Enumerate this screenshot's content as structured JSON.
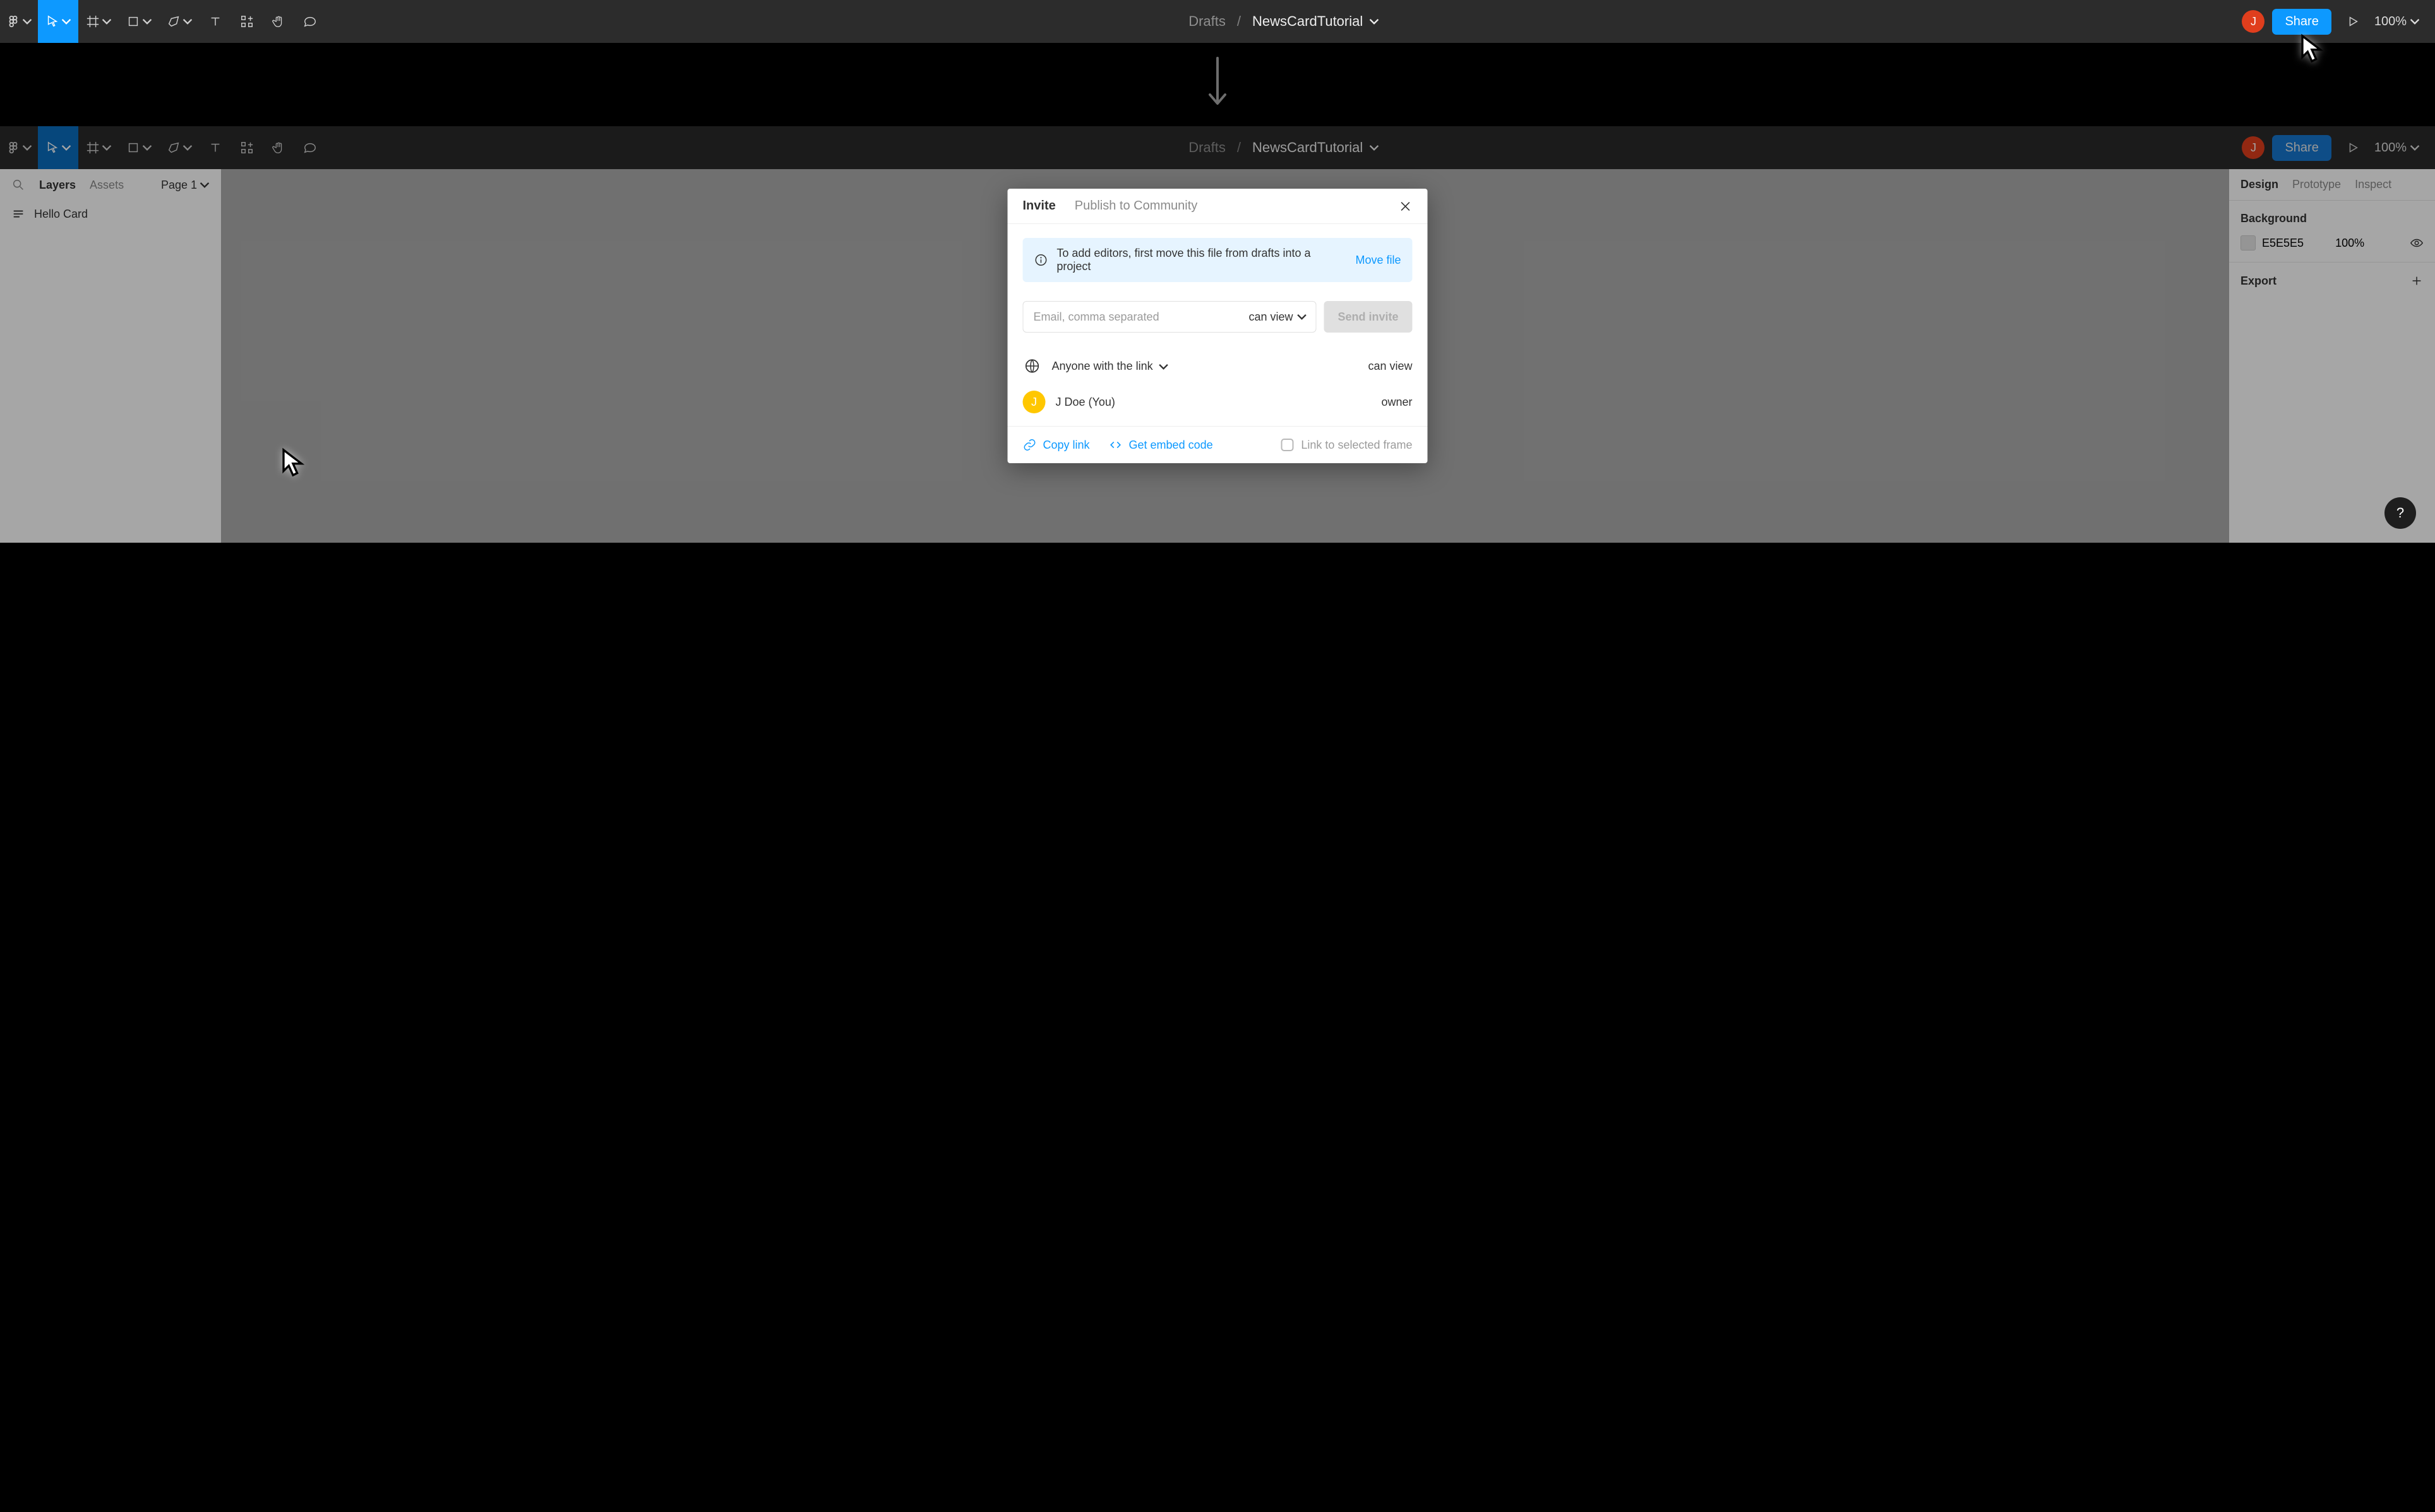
{
  "breadcrumb": {
    "drafts": "Drafts",
    "filename": "NewsCardTutorial"
  },
  "avatar": {
    "letter": "J",
    "color_top": "#e03e1d"
  },
  "share_label": "Share",
  "zoom_label": "100%",
  "left_panel": {
    "tabs": {
      "layers": "Layers",
      "assets": "Assets"
    },
    "page_selector": "Page 1",
    "layer_name": "Hello Card"
  },
  "right_panel": {
    "tabs": {
      "design": "Design",
      "prototype": "Prototype",
      "inspect": "Inspect"
    },
    "background_title": "Background",
    "background_hex": "E5E5E5",
    "background_opacity": "100%",
    "export_title": "Export"
  },
  "dialog": {
    "tabs": {
      "invite": "Invite",
      "publish": "Publish to Community"
    },
    "info_text": "To add editors, first move this file from drafts into a project",
    "info_action": "Move file",
    "email_placeholder": "Email, comma separated",
    "invite_perm": "can view",
    "send_button": "Send invite",
    "anyone_label": "Anyone with the link",
    "anyone_perm": "can view",
    "member_name": "J Doe (You)",
    "member_role": "owner",
    "copy_link": "Copy link",
    "embed_code": "Get embed code",
    "frame_link": "Link to selected frame"
  }
}
